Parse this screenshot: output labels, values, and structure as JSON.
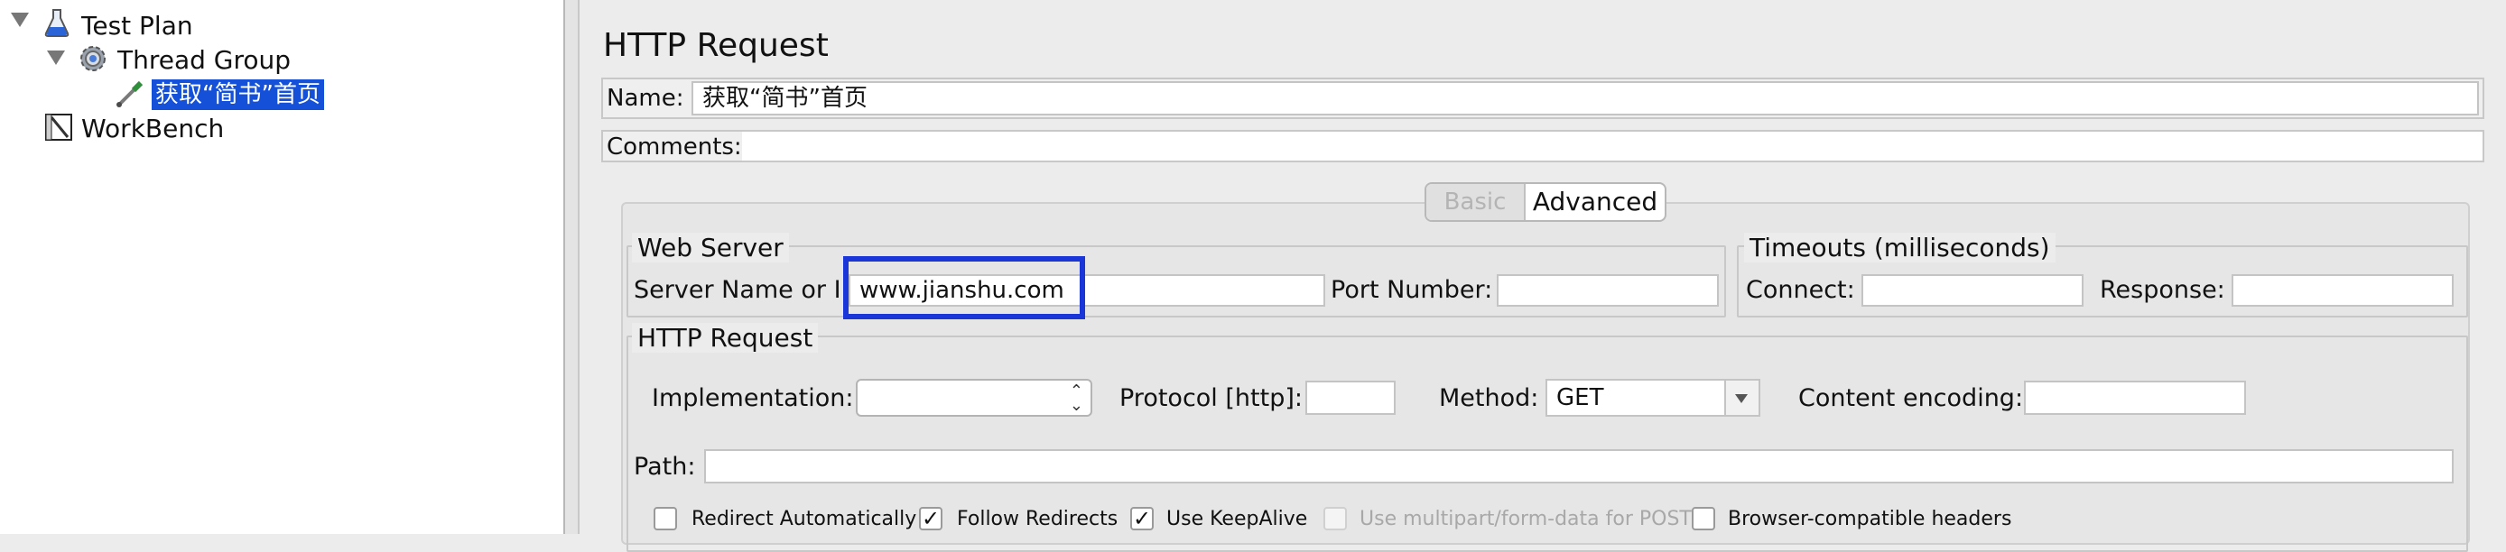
{
  "tree": {
    "items": [
      {
        "label": "Test Plan",
        "icon": "flask-icon"
      },
      {
        "label": "Thread Group",
        "icon": "gear-icon"
      },
      {
        "label": "获取“简书”首页",
        "icon": "dropper-icon"
      },
      {
        "label": "WorkBench",
        "icon": "workbench-icon"
      }
    ]
  },
  "panel": {
    "title": "HTTP Request",
    "name_label": "Name:",
    "name_value": "获取“简书”首页",
    "comments_label": "Comments:"
  },
  "tabs": {
    "basic": "Basic",
    "advanced": "Advanced"
  },
  "web_server": {
    "legend": "Web Server",
    "server_label": "Server Name or IP:",
    "server_value": "www.jianshu.com",
    "port_label": "Port Number:"
  },
  "timeouts": {
    "legend": "Timeouts (milliseconds)",
    "connect_label": "Connect:",
    "response_label": "Response:"
  },
  "http_request": {
    "legend": "HTTP Request",
    "implementation_label": "Implementation:",
    "protocol_label": "Protocol [http]:",
    "method_label": "Method:",
    "method_value": "GET",
    "encoding_label": "Content encoding:",
    "path_label": "Path:"
  },
  "options": [
    {
      "label": "Redirect Automatically",
      "checked": false,
      "enabled": true
    },
    {
      "label": "Follow Redirects",
      "checked": true,
      "enabled": true
    },
    {
      "label": "Use KeepAlive",
      "checked": true,
      "enabled": true
    },
    {
      "label": "Use multipart/form-data for POST",
      "checked": false,
      "enabled": false
    },
    {
      "label": "Browser-compatible headers",
      "checked": false,
      "enabled": true
    }
  ],
  "colors": {
    "selection": "#1450d8",
    "highlight_box": "#1a35d8"
  }
}
